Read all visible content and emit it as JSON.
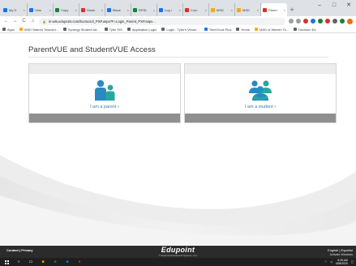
{
  "browser": {
    "tabs": [
      {
        "label": "My D",
        "color": "#1a73e8"
      },
      {
        "label": "Virtu",
        "color": "#1a73e8"
      },
      {
        "label": "Copy",
        "color": "#188038"
      },
      {
        "label": "Stude",
        "color": "#d93025"
      },
      {
        "label": "Black",
        "color": "#1a73e8"
      },
      {
        "label": "RPIN",
        "color": "#188038"
      },
      {
        "label": "Log i",
        "color": "#1a73e8"
      },
      {
        "label": "Com",
        "color": "#d93025"
      },
      {
        "label": "MSD",
        "color": "#f9ab00"
      },
      {
        "label": "MSD",
        "color": "#f9ab00"
      },
      {
        "label": "Paren",
        "color": "#d93025",
        "active": true
      }
    ],
    "new_tab": "+",
    "window_controls": [
      "–",
      "□",
      "✕"
    ],
    "nav": {
      "back": "←",
      "forward": "→",
      "reload": "C",
      "home": "⌂"
    },
    "url": "in-wts.edupoint.com/Eunscool_PXP.aspx?F=Login_Parent_PXP.aspx...",
    "bookmarks": [
      {
        "label": "Apps",
        "color": "#5f6368"
      },
      {
        "label": "MSD Warren Townshi...",
        "color": "#f9ab00"
      },
      {
        "label": "Synergy Student Ad...",
        "color": "#5f6368"
      },
      {
        "label": "Tyler SIS",
        "color": "#5f6368"
      },
      {
        "label": "Application Login",
        "color": "#5f6368"
      },
      {
        "label": "Login - Tyler's Venue...",
        "color": "#5f6368"
      },
      {
        "label": "TimeClock Plus",
        "color": "#1a73e8"
      },
      {
        "label": "Home",
        "color": "#5f6368"
      },
      {
        "label": "MSD of Warren To...",
        "color": "#f9ab00"
      },
      {
        "label": "Decision Ed",
        "color": "#5f6368"
      }
    ]
  },
  "page": {
    "title": "ParentVUE and StudentVUE Access",
    "parent_card": {
      "label": "I am a parent",
      "chevron": "›"
    },
    "student_card": {
      "label": "I am a student",
      "chevron": "›"
    }
  },
  "footer": {
    "contact": "Contact",
    "separator": "|",
    "privacy": "Privacy",
    "brand": "Edupoint",
    "copyright": "© Edupoint Educational Systems, LLC",
    "english": "English",
    "espanol": "Español",
    "activation": "Activate Windows",
    "activation_sub": "Go to Settings to activate Windows."
  },
  "taskbar": {
    "time": "8:25 AM",
    "date": "4/28/2020"
  },
  "colors": {
    "accent_link": "#3a7bbf",
    "icon_blue": "#2a8ac0",
    "icon_teal": "#2aa6a1",
    "card_bottom": "#8f8f8f",
    "footer_bg": "#2b2b2b"
  }
}
